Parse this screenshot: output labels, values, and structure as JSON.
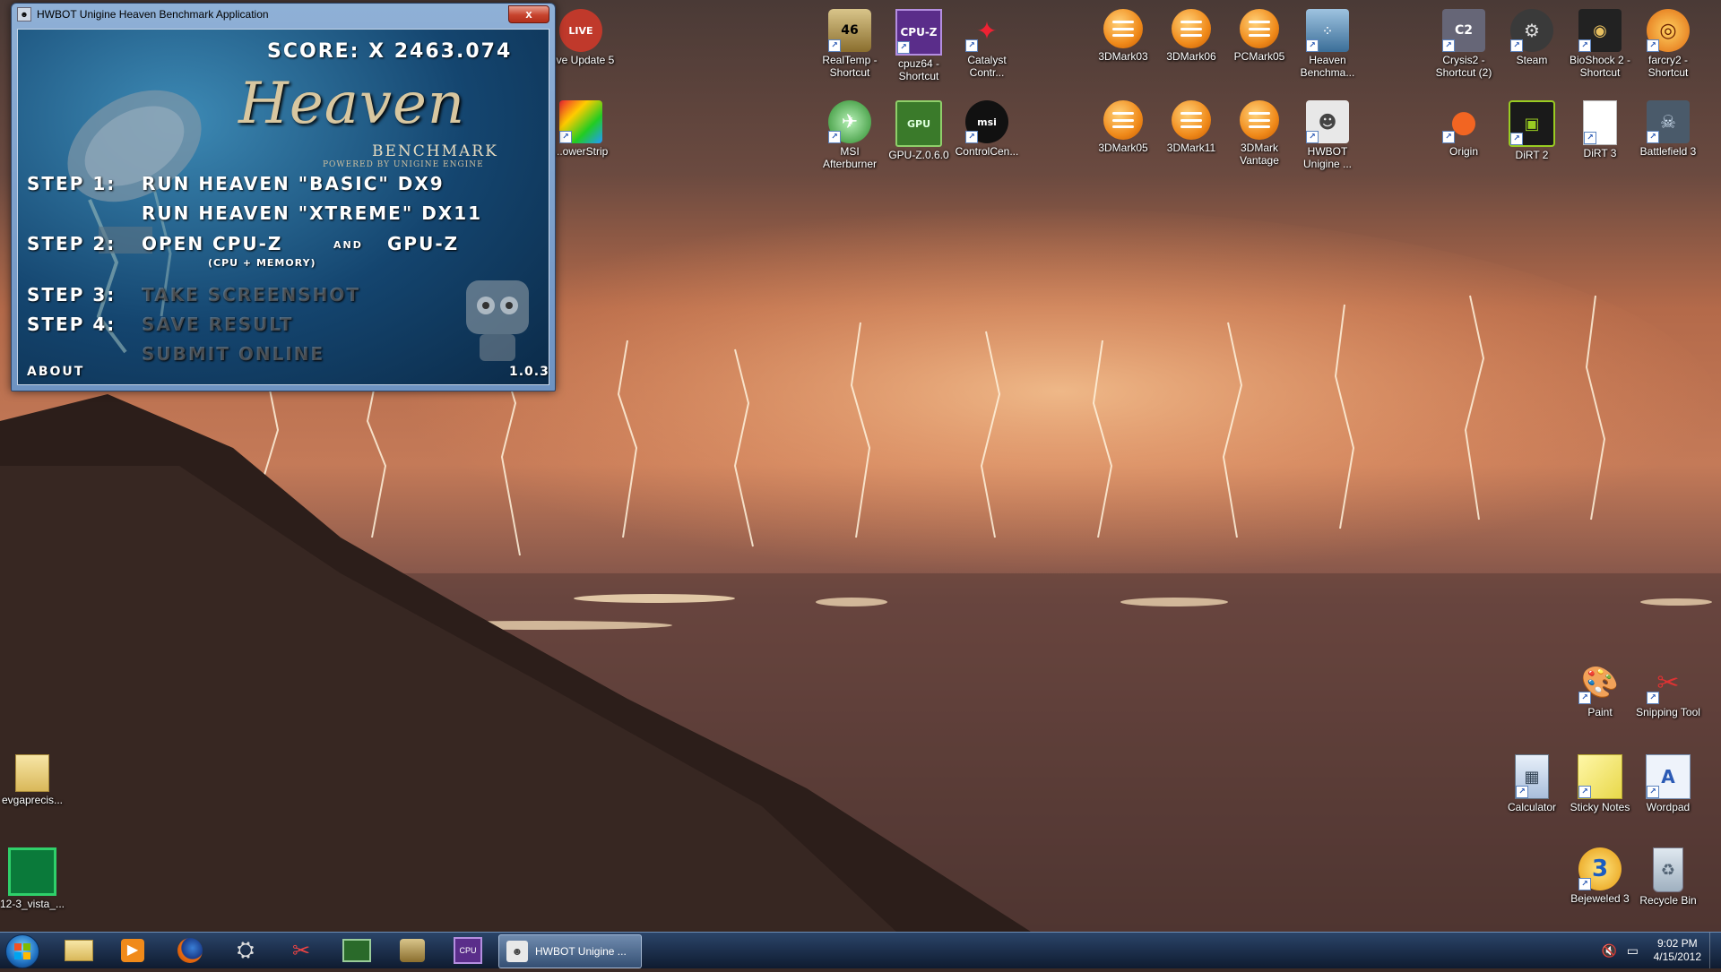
{
  "window": {
    "title": "HWBOT Unigine Heaven Benchmark Application",
    "close_label": "x",
    "score": "SCORE: X 2463.074",
    "logo_title": "Heaven",
    "logo_sub": "BENCHMARK",
    "logo_powered": "POWERED BY UNIGINE ENGINE",
    "step1_label": "STEP 1:",
    "step1_a": "RUN HEAVEN \"BASIC\" DX9",
    "step1_b": "RUN HEAVEN \"XTREME\" DX11",
    "step2_label": "STEP 2:",
    "step2_a": "OPEN CPU-Z",
    "step2_and": "AND",
    "step2_b": "GPU-Z",
    "step2_note": "(CPU + MEMORY)",
    "step3_label": "STEP 3:",
    "step3_action": "TAKE SCREENSHOT",
    "step4_label": "STEP 4:",
    "step4_action": "SAVE RESULT",
    "submit": "SUBMIT ONLINE",
    "about": "ABOUT",
    "version": "1.0.3"
  },
  "desktop_icons": [
    {
      "id": "live-update",
      "label": "...ve Update 5",
      "icon": "live-update-icon"
    },
    {
      "id": "powerstrip",
      "label": "...owerStrip",
      "icon": "powerstrip-icon"
    },
    {
      "id": "realtemp",
      "label": "RealTemp - Shortcut",
      "icon": "thermometer-icon"
    },
    {
      "id": "cpuz",
      "label": "cpuz64 - Shortcut",
      "icon": "cpuz-icon"
    },
    {
      "id": "catalyst",
      "label": "Catalyst Contr...",
      "icon": "catalyst-icon"
    },
    {
      "id": "3dmark03",
      "label": "3DMark03",
      "icon": "3dmark-icon"
    },
    {
      "id": "3dmark06",
      "label": "3DMark06",
      "icon": "3dmark-icon"
    },
    {
      "id": "pcmark05",
      "label": "PCMark05",
      "icon": "3dmark-icon"
    },
    {
      "id": "heaven",
      "label": "Heaven Benchma...",
      "icon": "heaven-icon"
    },
    {
      "id": "crysis2",
      "label": "Crysis2 - Shortcut (2)",
      "icon": "crysis-icon"
    },
    {
      "id": "steam",
      "label": "Steam",
      "icon": "steam-icon"
    },
    {
      "id": "bioshock2",
      "label": "BioShock 2 - Shortcut",
      "icon": "bioshock-icon"
    },
    {
      "id": "farcry2",
      "label": "farcry2 - Shortcut",
      "icon": "farcry-icon"
    },
    {
      "id": "msi-afterburner",
      "label": "MSI Afterburner",
      "icon": "afterburner-icon"
    },
    {
      "id": "gpuz",
      "label": "GPU-Z.0.6.0",
      "icon": "gpuz-icon"
    },
    {
      "id": "controlcenter",
      "label": "ControlCen...",
      "icon": "msi-icon"
    },
    {
      "id": "3dmark05",
      "label": "3DMark05",
      "icon": "3dmark-icon"
    },
    {
      "id": "3dmark11",
      "label": "3DMark11",
      "icon": "3dmark-icon"
    },
    {
      "id": "3dmark-vantage",
      "label": "3DMark Vantage",
      "icon": "3dmark-icon"
    },
    {
      "id": "hwbot-unigine",
      "label": "HWBOT Unigine ...",
      "icon": "hwbot-icon"
    },
    {
      "id": "origin",
      "label": "Origin",
      "icon": "origin-icon"
    },
    {
      "id": "dirt2",
      "label": "DiRT 2",
      "icon": "dirt-icon"
    },
    {
      "id": "dirt3",
      "label": "DiRT 3",
      "icon": "file-icon"
    },
    {
      "id": "battlefield3",
      "label": "Battlefield 3",
      "icon": "battlefield-icon"
    },
    {
      "id": "paint",
      "label": "Paint",
      "icon": "paint-icon"
    },
    {
      "id": "snipping",
      "label": "Snipping Tool",
      "icon": "snipping-icon"
    },
    {
      "id": "calculator",
      "label": "Calculator",
      "icon": "calculator-icon"
    },
    {
      "id": "sticky",
      "label": "Sticky Notes",
      "icon": "sticky-notes-icon"
    },
    {
      "id": "wordpad",
      "label": "Wordpad",
      "icon": "wordpad-icon"
    },
    {
      "id": "bejeweled3",
      "label": "Bejeweled 3",
      "icon": "bejeweled-icon"
    },
    {
      "id": "recycle",
      "label": "Recycle Bin",
      "icon": "recycle-bin-icon"
    },
    {
      "id": "evga",
      "label": "evgaprecis...",
      "icon": "folder-icon"
    },
    {
      "id": "amd-driver",
      "label": "12-3_vista_...",
      "icon": "amd-icon"
    }
  ],
  "taskbar": {
    "active_window": "HWBOT Unigine ...",
    "time": "9:02 PM",
    "date": "4/15/2012",
    "pinned": [
      "explorer-icon",
      "media-player-icon",
      "firefox-icon",
      "hardware-icon",
      "snipping-icon",
      "monitor-icon",
      "realtemp-icon",
      "cpuz-icon"
    ]
  }
}
